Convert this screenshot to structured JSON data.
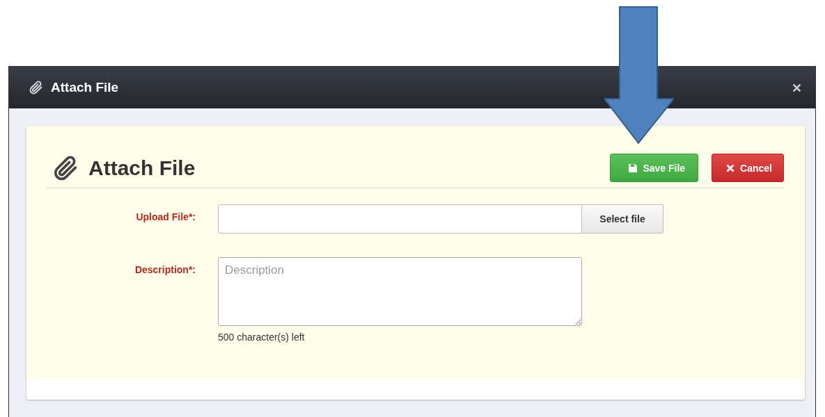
{
  "dialog": {
    "title": "Attach File"
  },
  "panel": {
    "heading": "Attach File",
    "buttons": [
      {
        "kind": "save",
        "label": "Save File"
      },
      {
        "kind": "cancel",
        "label": "Cancel"
      }
    ],
    "fields": [
      {
        "kind": "file",
        "label": "Upload File*:",
        "button": "Select file"
      },
      {
        "kind": "textarea",
        "label": "Description*:",
        "placeholder": "Description",
        "counter": "500 character(s) left"
      }
    ]
  }
}
